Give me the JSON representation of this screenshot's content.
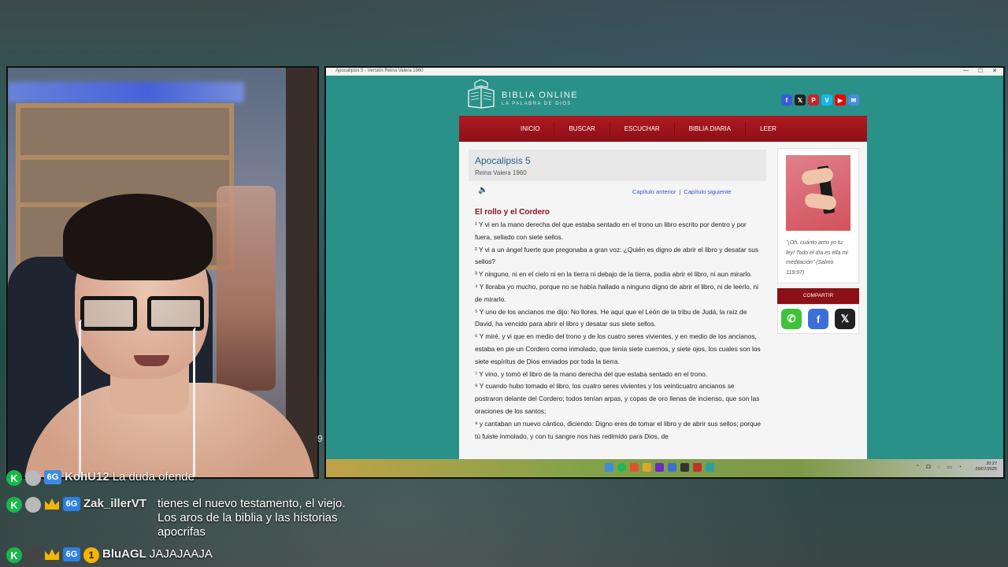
{
  "browser": {
    "tab_title": "Apocalipsis 5 - Versión Reina Valera 1960",
    "controls": [
      "—",
      "☐",
      "✕"
    ]
  },
  "site": {
    "logo_title": "BIBLIA ONLINE",
    "logo_subtitle": "LA PALABRA DE DIOS",
    "social_icons": [
      "facebook-icon",
      "x-icon",
      "pinterest-icon",
      "vimeo-icon",
      "youtube-icon",
      "mail-icon"
    ],
    "nav": [
      "INICIO",
      "BUSCAR",
      "ESCUCHAR",
      "BIBLIA DIARIA",
      "LEER"
    ],
    "chapter_title": "Apocalipsis 5",
    "version": "Reina Valera 1960",
    "prev_chapter": "Capítulo anterior",
    "separator": "|",
    "next_chapter": "Capítulo siguiente",
    "section_title": "El rollo y el Cordero",
    "verses": [
      "¹ Y vi en la mano derecha del que estaba sentado en el trono un libro escrito por dentro y por fuera, sellado con siete sellos.",
      "² Y vi a un ángel fuerte que pregonaba a gran voz: ¿Quién es digno de abrir el libro y desatar sus sellos?",
      "³ Y ninguno, ni en el cielo ni en la tierra ni debajo de la tierra, podía abrir el libro, ni aun mirarlo.",
      "⁴ Y lloraba yo mucho, porque no se había hallado a ninguno digno de abrir el libro, ni de leerlo, ni de mirarlo.",
      "⁵ Y uno de los ancianos me dijo: No llores. He aquí que el León de la tribu de Judá, la raíz de David, ha vencido para abrir el libro y desatar sus siete sellos.",
      "⁶ Y miré, y vi que en medio del trono y de los cuatro seres vivientes, y en medio de los ancianos, estaba en pie un Cordero como inmolado, que tenía siete cuernos, y siete ojos, los cuales son los siete espíritus de Dios enviados por toda la tierra.",
      "⁷ Y vino, y tomó el libro de la mano derecha del que estaba sentado en el trono.",
      "⁸ Y cuando hubo tomado el libro, los cuatro seres vivientes y los veinticuatro ancianos se postraron delante del Cordero; todos tenían arpas, y copas de oro llenas de incienso, que son las oraciones de los santos;",
      "⁹ y cantaban un nuevo cántico, diciendo: Digno eres de tomar el libro y de abrir sus sellos; porque tú fuiste inmolado, y con tu sangre nos has redimido para Dios, de"
    ],
    "sidebar_quote": "\"¡Oh, cuánto amo yo tu ley! Todo el día es ella mi meditación\" (Salmo 119:97)",
    "share_label": "COMPARTIR",
    "share_buttons": [
      "whatsapp-icon",
      "facebook-icon",
      "x-icon"
    ]
  },
  "taskbar": {
    "time": "20:27",
    "date": "29/07/2025"
  },
  "stray_char": "9",
  "chat": [
    {
      "user": "KohU12",
      "message": "La duda ofende"
    },
    {
      "user": "Zak_illerVT",
      "message": "tienes el nuevo testamento, el viejo. Los aros de la biblia y las historias apocrifas"
    },
    {
      "user": "BluAGL",
      "message": "JAJAJAAJA",
      "bits": "1"
    }
  ],
  "colors": {
    "teal_background": "#2a9189",
    "nav_red": "#8c1018",
    "link_blue": "#3355cc",
    "title_blue": "#2a5f86"
  }
}
